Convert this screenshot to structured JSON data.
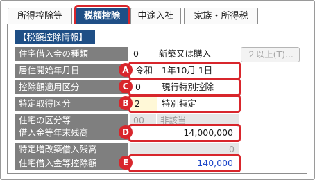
{
  "tabs": [
    {
      "label": "所得控除等"
    },
    {
      "label": "税額控除"
    },
    {
      "label": "中途入社"
    },
    {
      "label": "家族・所得税"
    }
  ],
  "section": {
    "header": "【税額控除情報】"
  },
  "rows": {
    "loan_type": {
      "label": "住宅借入金の種類",
      "code": "0",
      "value": "新築又は購入",
      "button": "２以上(T)..."
    },
    "move_in_date": {
      "label": "居住開始年月日",
      "era": "令和",
      "date": "1年10月  1日",
      "badge": "A"
    },
    "deduction_type": {
      "label": "控除額適用区分",
      "code": "0",
      "value": "現行特別控除",
      "badge": "C"
    },
    "special_type": {
      "label": "特定取得区分",
      "code": "2",
      "value": "特別特定",
      "badge": "B"
    },
    "housing_type": {
      "label": "住宅の区分等",
      "code": "00",
      "value": "非該当"
    },
    "year_end_balance": {
      "label": "借入金等年末残高",
      "value": "14,000,000",
      "badge": "D"
    },
    "renovation_balance": {
      "label": "特定増改築借入残高",
      "value": "0"
    },
    "deduction_amount": {
      "label": "住宅借入金等控除額",
      "value": "140,000",
      "badge": "E"
    }
  },
  "colors": {
    "accent_navy": "#1f4f86",
    "highlight_red": "#d8262c",
    "label_gray": "#7f7f7f",
    "value_blue": "#1d47c8"
  }
}
